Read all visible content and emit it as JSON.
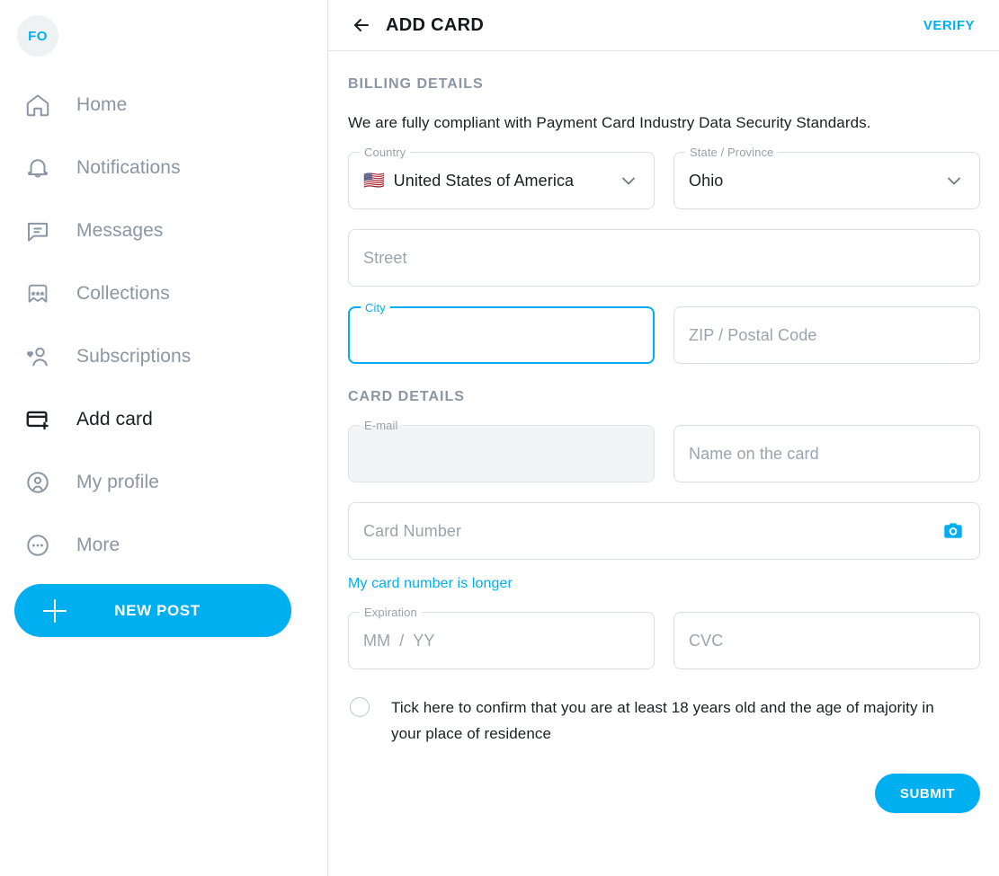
{
  "sidebar": {
    "avatar": {
      "initials": "FO",
      "name": "avatar"
    },
    "items": [
      {
        "label": "Home",
        "icon": "home-icon",
        "active": false
      },
      {
        "label": "Notifications",
        "icon": "bell-icon",
        "active": false
      },
      {
        "label": "Messages",
        "icon": "message-icon",
        "active": false
      },
      {
        "label": "Collections",
        "icon": "bookmark-stars-icon",
        "active": false
      },
      {
        "label": "Subscriptions",
        "icon": "user-heart-icon",
        "active": false
      },
      {
        "label": "Add card",
        "icon": "credit-card-plus-icon",
        "active": true
      },
      {
        "label": "My profile",
        "icon": "user-circle-icon",
        "active": false
      },
      {
        "label": "More",
        "icon": "ellipsis-circle-icon",
        "active": false
      }
    ],
    "new_post_label": "NEW POST"
  },
  "topbar": {
    "back_icon": "arrow-left-icon",
    "title": "ADD CARD",
    "verify_label": "VERIFY"
  },
  "billing": {
    "section_title": "BILLING DETAILS",
    "compliance_text": "We are fully compliant with Payment Card Industry Data Security Standards.",
    "country": {
      "legend": "Country",
      "value": "United States of America",
      "flag": "🇺🇸"
    },
    "state": {
      "legend": "State / Province",
      "value": "Ohio"
    },
    "street": {
      "placeholder": "Street",
      "value": ""
    },
    "city": {
      "legend": "City",
      "value": "",
      "focused": true
    },
    "zip": {
      "placeholder": "ZIP / Postal Code",
      "value": ""
    }
  },
  "card": {
    "section_title": "CARD DETAILS",
    "email": {
      "legend": "E-mail",
      "value": "",
      "disabled": true
    },
    "name_on_card": {
      "placeholder": "Name on the card",
      "value": ""
    },
    "card_number": {
      "placeholder": "Card Number",
      "value": "",
      "icon": "camera-icon"
    },
    "longer_link": "My card number is longer",
    "expiration": {
      "legend": "Expiration",
      "month_placeholder": "MM",
      "separator": "/",
      "year_placeholder": "YY"
    },
    "cvc": {
      "placeholder": "CVC",
      "value": ""
    }
  },
  "consent": {
    "text": "Tick here to confirm that you are at least 18 years old and the age of majority in your place of residence",
    "checked": false
  },
  "submit": {
    "label": "SUBMIT"
  },
  "colors": {
    "accent": "#00aff0",
    "muted": "#8a96a3",
    "text": "#1b1f23",
    "border": "#d8dee4",
    "disabled_bg": "#f2f4f6"
  }
}
